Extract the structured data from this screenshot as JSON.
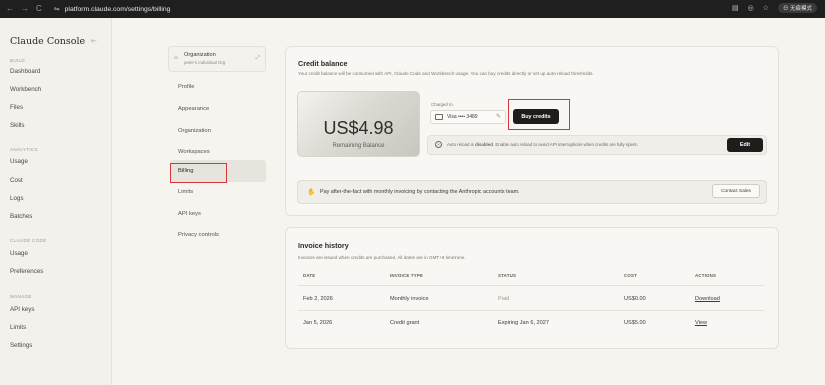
{
  "browser": {
    "back_icon": "←",
    "forward_icon": "→",
    "reload_icon": "C",
    "url": "platform.claude.com/settings/billing",
    "profile_label": "无痕模式"
  },
  "sidebar": {
    "brand": "Claude Console",
    "sections": [
      {
        "label": "BUILD",
        "items": [
          "Dashboard",
          "Workbench",
          "Files",
          "Skills"
        ]
      },
      {
        "label": "ANALYTICS",
        "items": [
          "Usage",
          "Cost",
          "Logs",
          "Batches"
        ]
      },
      {
        "label": "CLAUDE CODE",
        "items": [
          "Usage",
          "Preferences"
        ]
      },
      {
        "label": "MANAGE",
        "items": [
          "API keys",
          "Limits",
          "Settings"
        ]
      }
    ]
  },
  "settings_nav": {
    "org_title": "Organization",
    "org_subtitle": "peter's Individual Org",
    "items": [
      "Profile",
      "Appearance",
      "Organization",
      "Workspaces",
      "Billing",
      "Limits",
      "API keys",
      "Privacy controls"
    ],
    "active": "Billing"
  },
  "credit": {
    "title": "Credit balance",
    "description": "Your credit balance will be consumed with API, Claude Code and Workbench usage. You can buy credits directly or set up auto-reload thresholds.",
    "amount": "US$4.98",
    "amount_label": "Remaining Balance",
    "charged_to_label": "Charged to",
    "card": "Visa •••• 3489",
    "buy_button": "Buy credits",
    "auto_reload_prefix": "Auto reload is ",
    "auto_reload_status": "disabled",
    "auto_reload_suffix": ". Enable auto reload to avoid API interruptions when credits are fully spent.",
    "edit_button": "Edit",
    "invoice_note": "Pay after-the-fact with monthly invoicing by contacting the Anthropic accounts team.",
    "contact_button": "Contact Sales"
  },
  "invoices": {
    "title": "Invoice history",
    "description": "Invoices are issued when credits are purchased. All dates are in GMT+8 timezone.",
    "columns": [
      "DATE",
      "INVOICE TYPE",
      "STATUS",
      "COST",
      "ACTIONS"
    ],
    "rows": [
      {
        "date": "Feb 2, 2026",
        "type": "Monthly invoice",
        "status": "Paid",
        "cost": "US$0.00",
        "action": "Download"
      },
      {
        "date": "Jan 5, 2026",
        "type": "Credit grant",
        "status": "Expiring Jan 6, 2027",
        "cost": "US$5.00",
        "action": "View"
      }
    ]
  },
  "colors": {
    "highlight": "#d4383a",
    "button_dark": "#1e1d1b",
    "background": "#f5f4ef"
  }
}
